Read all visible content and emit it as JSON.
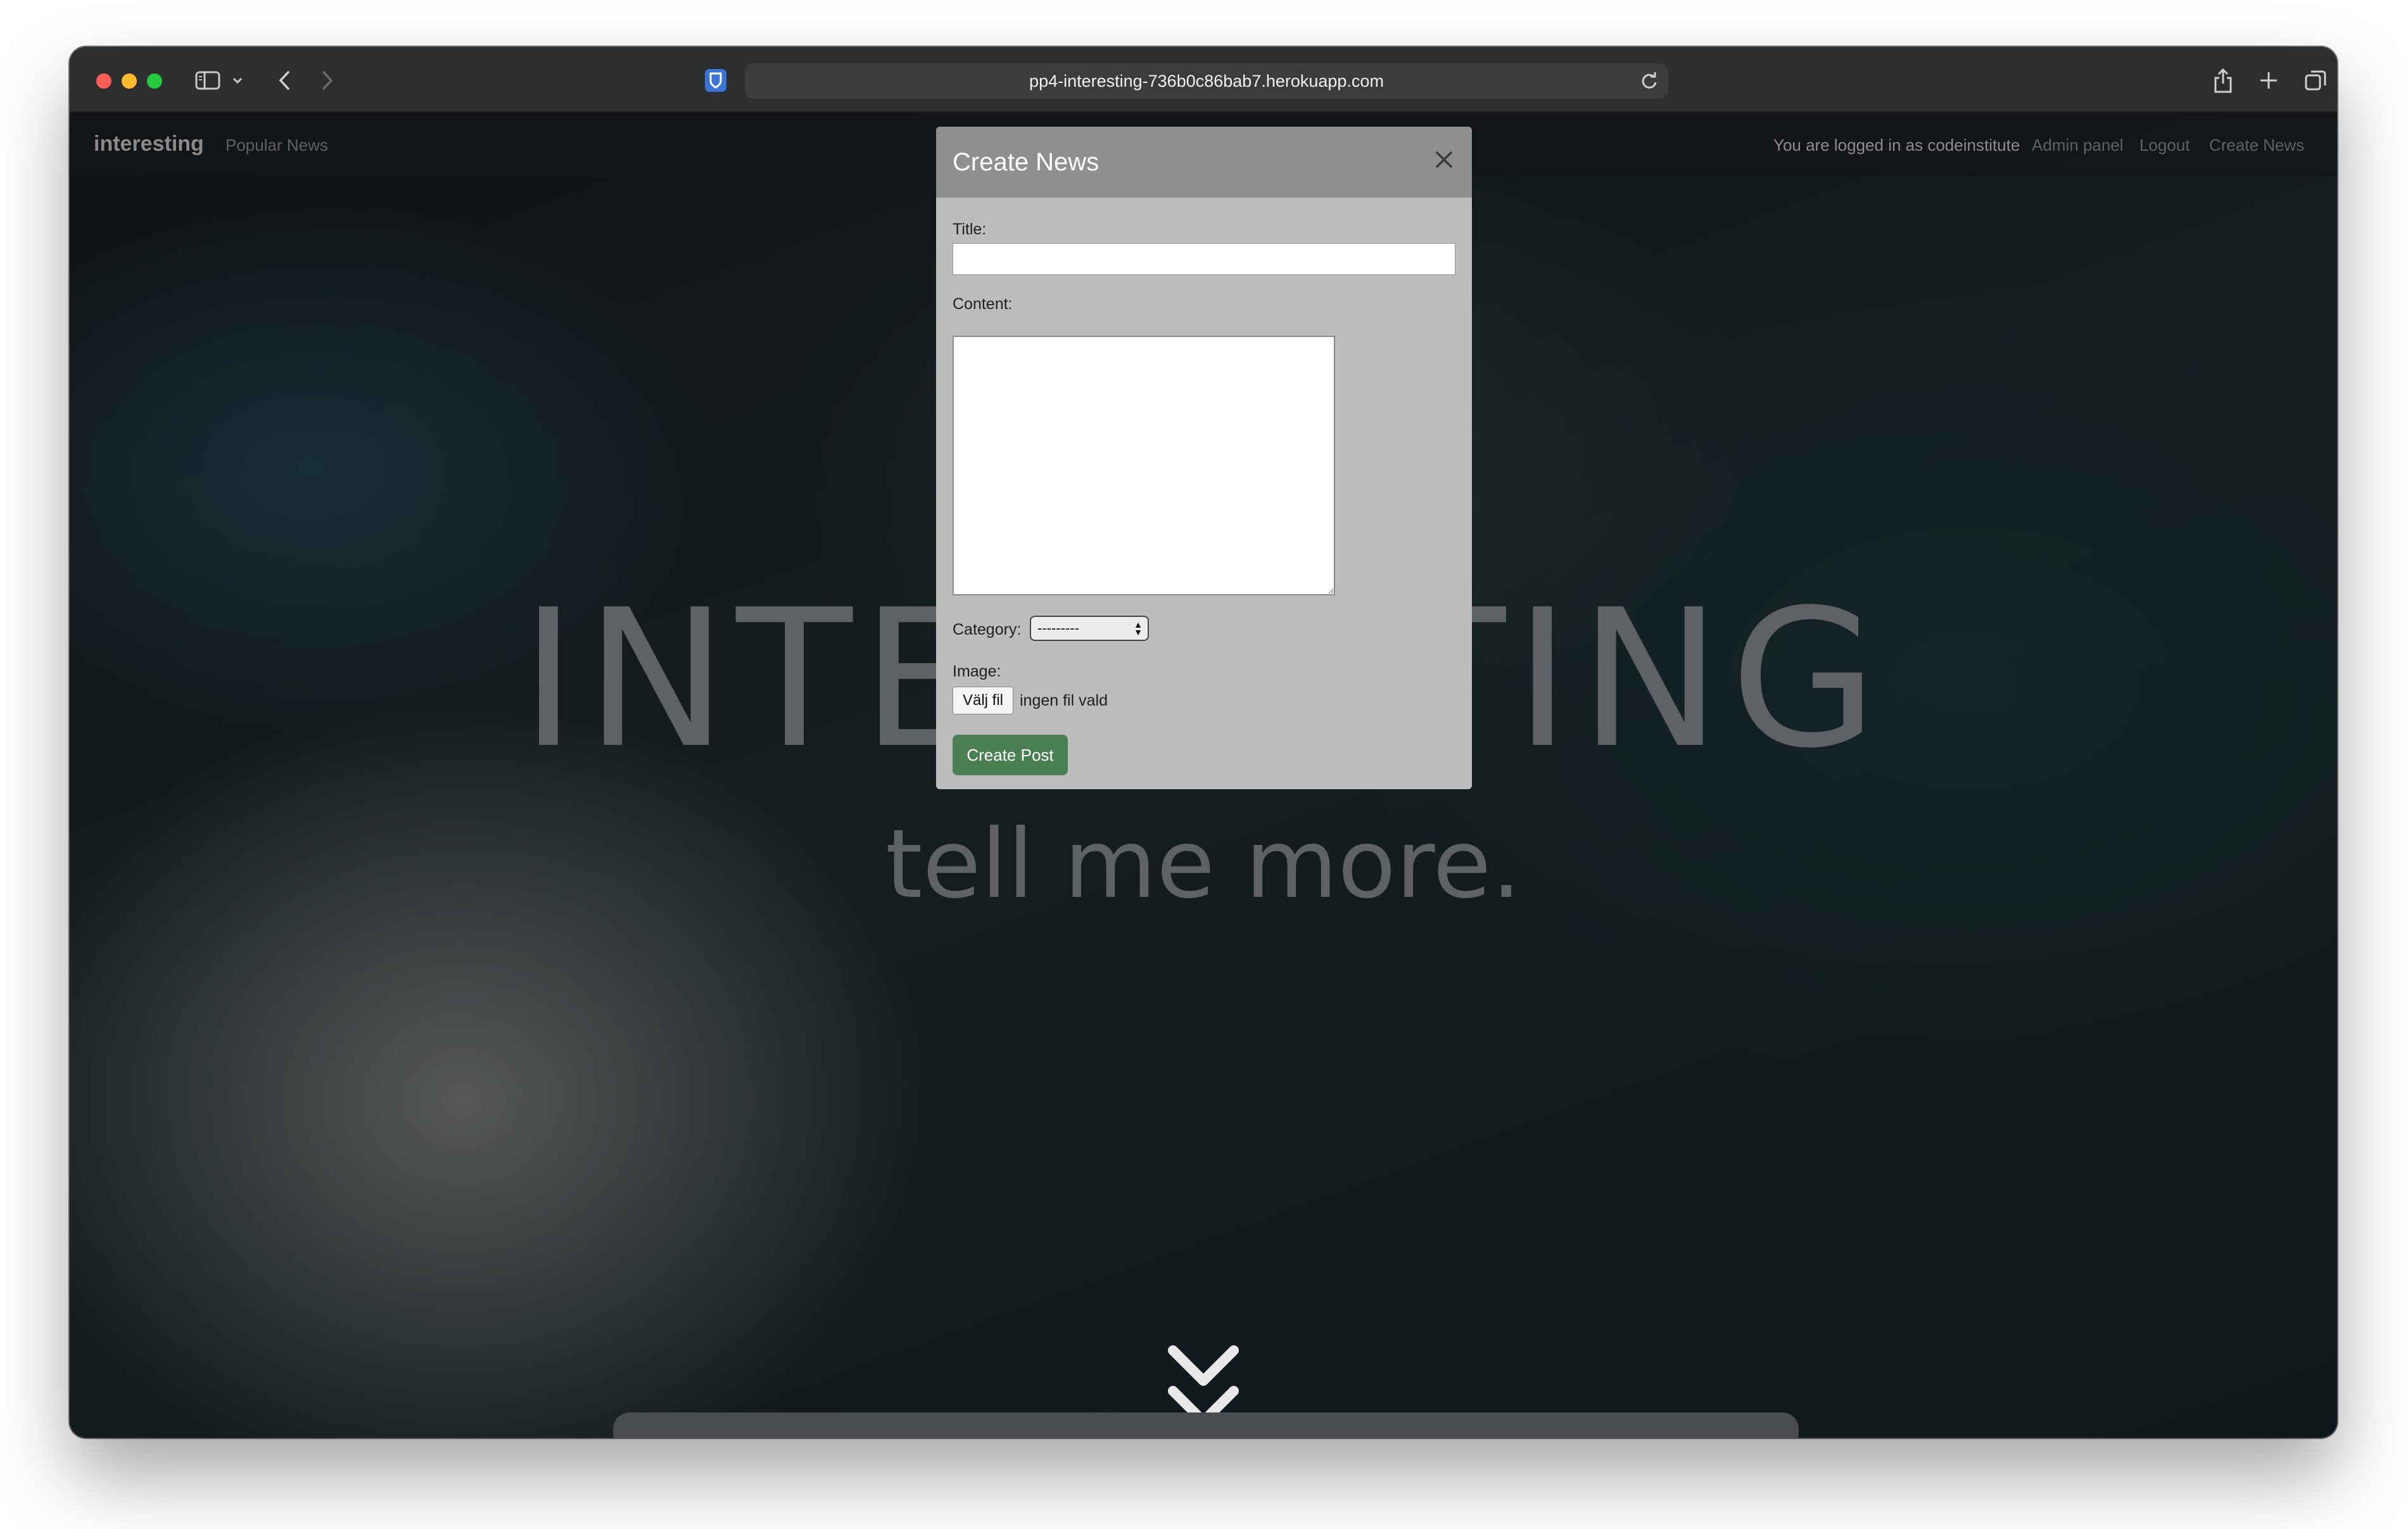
{
  "browser": {
    "url": "pp4-interesting-736b0c86bab7.herokuapp.com"
  },
  "navbar": {
    "brand": "interesting",
    "popular_news": "Popular News",
    "logged_in_text": "You are logged in as codeinstitute",
    "admin_panel": "Admin panel",
    "logout": "Logout",
    "create_news": "Create News"
  },
  "hero": {
    "title": "INTERESTING",
    "subtitle": "tell me more."
  },
  "modal": {
    "title": "Create News",
    "title_label": "Title:",
    "title_value": "",
    "content_label": "Content:",
    "content_value": "",
    "category_label": "Category:",
    "category_selected": "---------",
    "image_label": "Image:",
    "file_button": "Välj fil",
    "file_status": "ingen fil vald",
    "submit": "Create Post"
  },
  "icons": {
    "sidebar": "sidebar-icon",
    "back": "back-icon",
    "forward": "forward-icon",
    "password_manager": "shield-icon",
    "reload": "reload-icon",
    "share": "share-icon",
    "new_tab": "plus-icon",
    "tabs": "tabs-icon",
    "close": "close-icon",
    "scroll_down": "double-chevron-down-icon"
  },
  "colors": {
    "submit_button": "#4a7f52",
    "modal_header": "#8f8f8f",
    "modal_body": "#bdbdbd"
  }
}
